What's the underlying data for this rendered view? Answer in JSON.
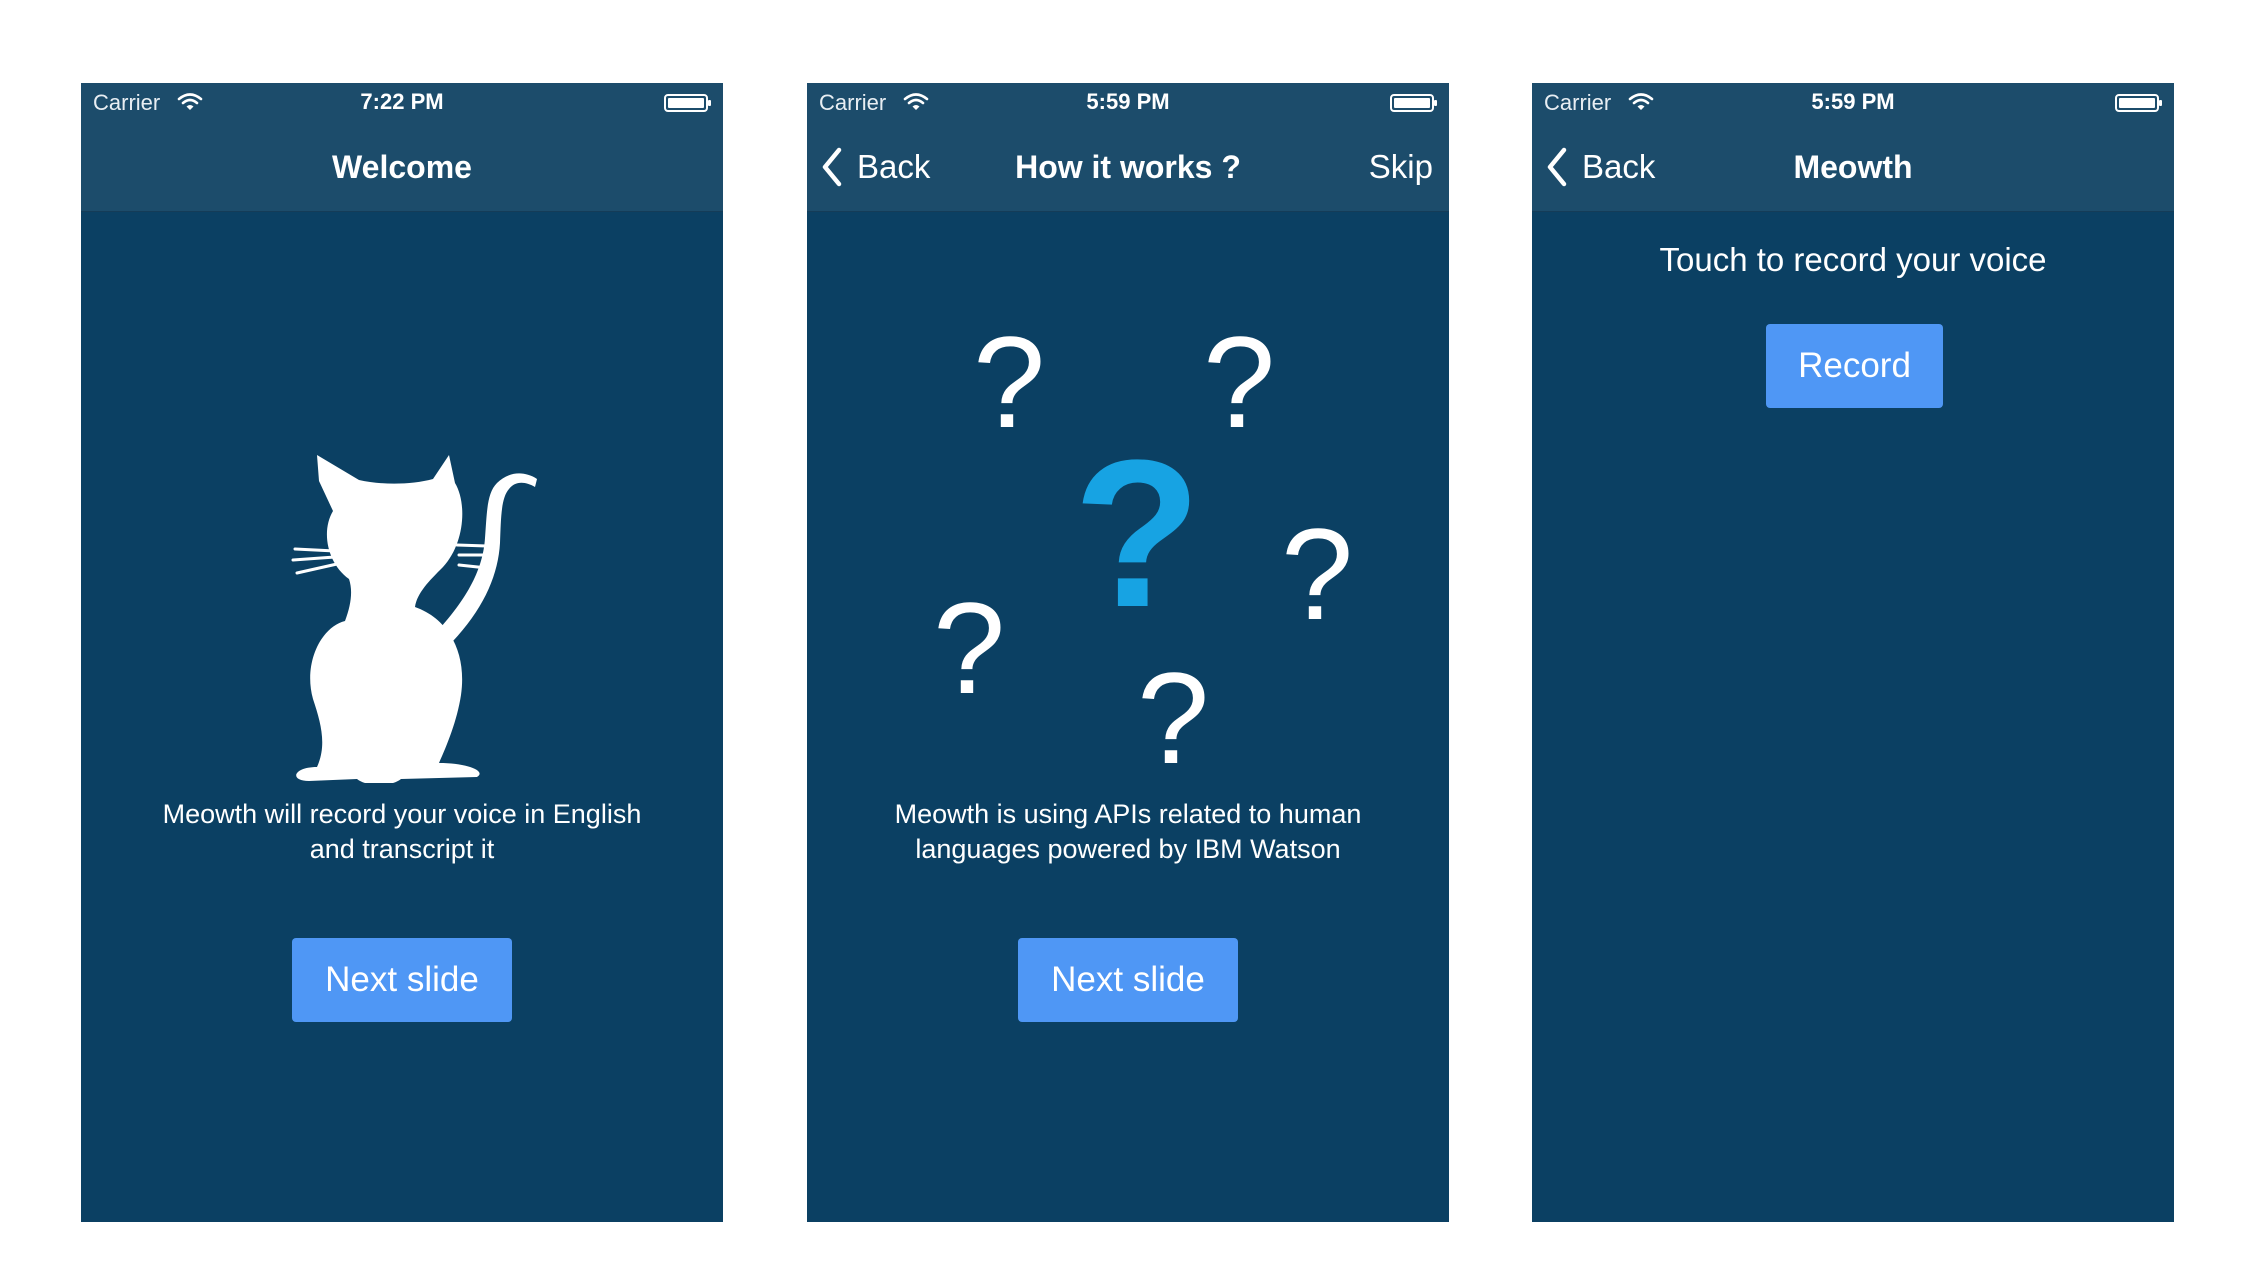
{
  "screens": [
    {
      "status": {
        "carrier": "Carrier",
        "time": "7:22 PM"
      },
      "nav": {
        "title": "Welcome"
      },
      "illustration": "cat-icon",
      "description_line1": "Meowth will record your voice in English",
      "description_line2": "and transcript it",
      "button_label": "Next slide"
    },
    {
      "status": {
        "carrier": "Carrier",
        "time": "5:59 PM"
      },
      "nav": {
        "back_label": "Back",
        "title": "How it works ?",
        "skip_label": "Skip"
      },
      "illustration": "question-marks",
      "question_mark": "?",
      "description_line1": "Meowth is using APIs related to human",
      "description_line2": "languages powered by IBM Watson",
      "button_label": "Next slide"
    },
    {
      "status": {
        "carrier": "Carrier",
        "time": "5:59 PM"
      },
      "nav": {
        "back_label": "Back",
        "title": "Meowth"
      },
      "prompt": "Touch to record your voice",
      "button_label": "Record"
    }
  ],
  "colors": {
    "screen_background": "#0b4063",
    "bar_background": "#1c4c6b",
    "button": "#4f97f5",
    "accent_question": "#17a3e3"
  }
}
